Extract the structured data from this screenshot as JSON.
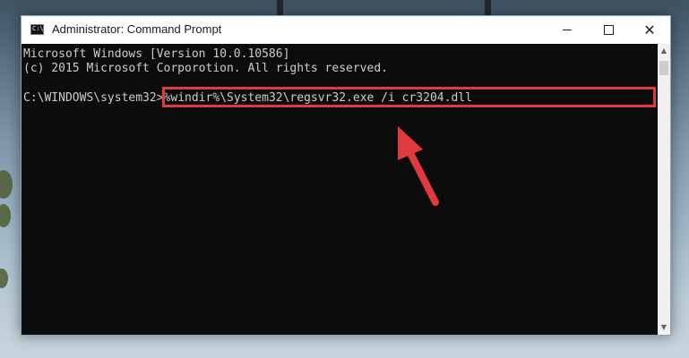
{
  "window": {
    "title": "Administrator: Command Prompt",
    "icon": "console-app-icon",
    "icon_glyph": "C:\\",
    "buttons": {
      "minimize": "minimize-icon",
      "maximize": "maximize-icon",
      "close": "close-icon",
      "close_glyph": "✕"
    }
  },
  "console": {
    "lines": [
      "Microsoft Windows [Version 10.0.10586]",
      "(c) 2015 Microsoft Corporotion. All rights reserved."
    ],
    "prompt": "C:\\WINDOWS\\system32>",
    "command": "%windir%\\System32\\regsvr32.exe /i cr3204.dll"
  },
  "scrollbar": {
    "up_glyph": "▲",
    "down_glyph": "▼"
  },
  "annotation": {
    "highlight_color": "#e0393e",
    "arrow_color": "#e0393e"
  },
  "colors": {
    "console_bg": "#0c0c0c",
    "console_text": "#cccccc",
    "titlebar_bg": "#ffffff"
  }
}
